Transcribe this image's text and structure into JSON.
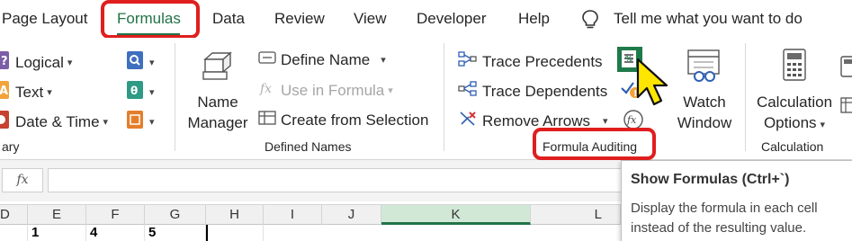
{
  "tabs": [
    {
      "label": "Page Layout"
    },
    {
      "label": "Formulas"
    },
    {
      "label": "Data"
    },
    {
      "label": "Review"
    },
    {
      "label": "View"
    },
    {
      "label": "Developer"
    },
    {
      "label": "Help"
    }
  ],
  "tell_me": {
    "placeholder": "Tell me what you want to do"
  },
  "function_library": {
    "logical_label": "Logical",
    "text_label": "Text",
    "datetime_label": "Date & Time",
    "group_label": "ary"
  },
  "defined_names": {
    "name_manager_line1": "Name",
    "name_manager_line2": "Manager",
    "define_name_label": "Define Name",
    "use_in_formula_label": "Use in Formula",
    "create_from_selection_label": "Create from Selection",
    "group_label": "Defined Names"
  },
  "formula_auditing": {
    "trace_precedents_label": "Trace Precedents",
    "trace_dependents_label": "Trace Dependents",
    "remove_arrows_label": "Remove Arrows",
    "watch_window_line1": "Watch",
    "watch_window_line2": "Window",
    "group_label": "Formula Auditing"
  },
  "calculation": {
    "options_line1": "Calculation",
    "options_line2": "Options",
    "group_label": "Calculation"
  },
  "formula_bar": {
    "fx_label": "fx",
    "value": ""
  },
  "columns": [
    {
      "label": "D"
    },
    {
      "label": "E"
    },
    {
      "label": "F"
    },
    {
      "label": "G"
    },
    {
      "label": "H"
    },
    {
      "label": "I"
    },
    {
      "label": "J"
    },
    {
      "label": "K"
    },
    {
      "label": "L"
    }
  ],
  "row1": {
    "e": "1",
    "f": "4",
    "g": "5"
  },
  "tooltip": {
    "title": "Show Formulas (Ctrl+`)",
    "description": "Display the formula in each cell instead of the resulting value."
  },
  "colors": {
    "accent_green": "#217346",
    "highlight_red": "#e01e1e",
    "cursor_yellow": "#ffe600"
  }
}
